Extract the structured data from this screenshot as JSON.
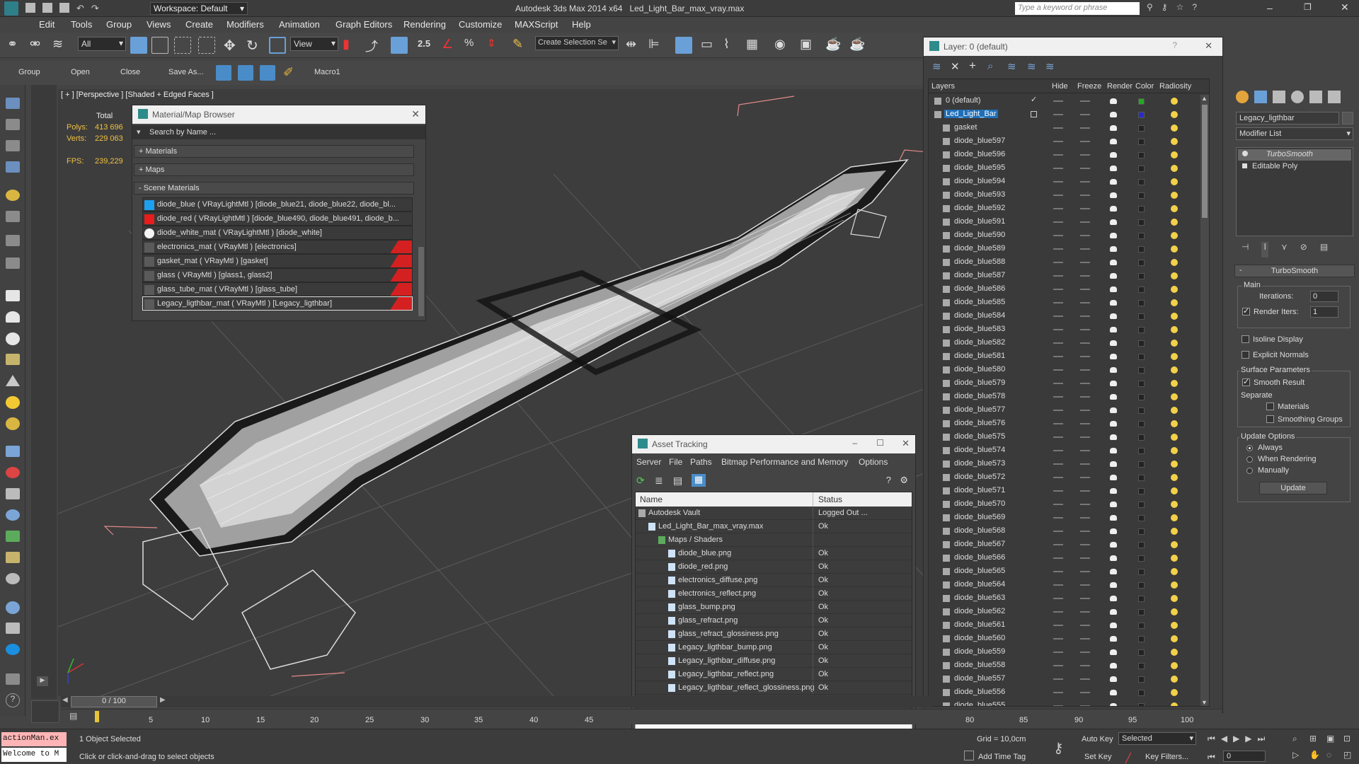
{
  "title_bar": {
    "workspace_label": "Workspace: Default",
    "app_title": "Autodesk 3ds Max  2014 x64",
    "file_title": "Led_Light_Bar_max_vray.max",
    "search_placeholder": "Type a keyword or phrase"
  },
  "menu": [
    "Edit",
    "Tools",
    "Group",
    "Views",
    "Create",
    "Modifiers",
    "Animation",
    "Graph Editors",
    "Rendering",
    "Customize",
    "MAXScript",
    "Help"
  ],
  "main_toolbar": {
    "selection_filter": "All",
    "ref_coord": "View",
    "snap_label": "2.5",
    "selection_set_placeholder": "Create Selection Se"
  },
  "ribbon": {
    "items": [
      "Group",
      "Open",
      "Close",
      "Save As..."
    ],
    "macro_label": "Macro1"
  },
  "viewport": {
    "label": "[ + ] [Perspective ] [Shaded + Edged Faces ]",
    "stats_total": "Total",
    "polys_label": "Polys:",
    "polys_value": "413 696",
    "verts_label": "Verts:",
    "verts_value": "229 063",
    "fps_label": "FPS:",
    "fps_value": "239,229"
  },
  "material_browser": {
    "title": "Material/Map Browser",
    "search_placeholder": "Search by Name ...",
    "sections": [
      "+ Materials",
      "+ Maps",
      "- Scene Materials"
    ],
    "items": [
      {
        "label": "diode_blue  ( VRayLightMtl ) [diode_blue21, diode_blue22, diode_bl...",
        "swatch": "#1ea0f0"
      },
      {
        "label": "diode_red  ( VRayLightMtl ) [diode_blue490, diode_blue491, diode_b...",
        "swatch": "#e81c1c"
      },
      {
        "label": "diode_white_mat  ( VRayLightMtl ) [diode_white]",
        "swatch": "#f4f4f4"
      },
      {
        "label": "electronics_mat  ( VRayMtl ) [electronics]",
        "swatch": "#5a5a5a"
      },
      {
        "label": "gasket_mat  ( VRayMtl ) [gasket]",
        "swatch": "#5a5a5a"
      },
      {
        "label": "glass  ( VRayMtl ) [glass1, glass2]",
        "swatch": "#5a5a5a"
      },
      {
        "label": "glass_tube_mat  ( VRayMtl ) [glass_tube]",
        "swatch": "#5a5a5a"
      },
      {
        "label": "Legacy_ligthbar_mat  ( VRayMtl ) [Legacy_ligthbar]",
        "swatch": "#5a5a5a"
      }
    ]
  },
  "layer_panel": {
    "title": "Layer: 0 (default)",
    "columns": [
      "Layers",
      "Hide",
      "Freeze",
      "Render",
      "Color",
      "Radiosity"
    ],
    "rows": [
      {
        "name": "0 (default)",
        "level": 0,
        "color": "#22aa22",
        "selected": false
      },
      {
        "name": "Led_Light_Bar",
        "level": 0,
        "color": "#2a2acc",
        "selected": true
      },
      {
        "name": "gasket",
        "level": 1,
        "color": "#222222",
        "selected": false
      },
      {
        "name": "diode_blue597",
        "level": 1,
        "color": "#222222",
        "selected": false
      },
      {
        "name": "diode_blue596",
        "level": 1,
        "color": "#222222",
        "selected": false
      },
      {
        "name": "diode_blue595",
        "level": 1,
        "color": "#222222",
        "selected": false
      },
      {
        "name": "diode_blue594",
        "level": 1,
        "color": "#222222",
        "selected": false
      },
      {
        "name": "diode_blue593",
        "level": 1,
        "color": "#222222",
        "selected": false
      },
      {
        "name": "diode_blue592",
        "level": 1,
        "color": "#222222",
        "selected": false
      },
      {
        "name": "diode_blue591",
        "level": 1,
        "color": "#222222",
        "selected": false
      },
      {
        "name": "diode_blue590",
        "level": 1,
        "color": "#222222",
        "selected": false
      },
      {
        "name": "diode_blue589",
        "level": 1,
        "color": "#222222",
        "selected": false
      },
      {
        "name": "diode_blue588",
        "level": 1,
        "color": "#222222",
        "selected": false
      },
      {
        "name": "diode_blue587",
        "level": 1,
        "color": "#222222",
        "selected": false
      },
      {
        "name": "diode_blue586",
        "level": 1,
        "color": "#222222",
        "selected": false
      },
      {
        "name": "diode_blue585",
        "level": 1,
        "color": "#222222",
        "selected": false
      },
      {
        "name": "diode_blue584",
        "level": 1,
        "color": "#222222",
        "selected": false
      },
      {
        "name": "diode_blue583",
        "level": 1,
        "color": "#222222",
        "selected": false
      },
      {
        "name": "diode_blue582",
        "level": 1,
        "color": "#222222",
        "selected": false
      },
      {
        "name": "diode_blue581",
        "level": 1,
        "color": "#222222",
        "selected": false
      },
      {
        "name": "diode_blue580",
        "level": 1,
        "color": "#222222",
        "selected": false
      },
      {
        "name": "diode_blue579",
        "level": 1,
        "color": "#222222",
        "selected": false
      },
      {
        "name": "diode_blue578",
        "level": 1,
        "color": "#222222",
        "selected": false
      },
      {
        "name": "diode_blue577",
        "level": 1,
        "color": "#222222",
        "selected": false
      },
      {
        "name": "diode_blue576",
        "level": 1,
        "color": "#222222",
        "selected": false
      },
      {
        "name": "diode_blue575",
        "level": 1,
        "color": "#222222",
        "selected": false
      },
      {
        "name": "diode_blue574",
        "level": 1,
        "color": "#222222",
        "selected": false
      },
      {
        "name": "diode_blue573",
        "level": 1,
        "color": "#222222",
        "selected": false
      },
      {
        "name": "diode_blue572",
        "level": 1,
        "color": "#222222",
        "selected": false
      },
      {
        "name": "diode_blue571",
        "level": 1,
        "color": "#222222",
        "selected": false
      },
      {
        "name": "diode_blue570",
        "level": 1,
        "color": "#222222",
        "selected": false
      },
      {
        "name": "diode_blue569",
        "level": 1,
        "color": "#222222",
        "selected": false
      },
      {
        "name": "diode_blue568",
        "level": 1,
        "color": "#222222",
        "selected": false
      },
      {
        "name": "diode_blue567",
        "level": 1,
        "color": "#222222",
        "selected": false
      },
      {
        "name": "diode_blue566",
        "level": 1,
        "color": "#222222",
        "selected": false
      },
      {
        "name": "diode_blue565",
        "level": 1,
        "color": "#222222",
        "selected": false
      },
      {
        "name": "diode_blue564",
        "level": 1,
        "color": "#222222",
        "selected": false
      },
      {
        "name": "diode_blue563",
        "level": 1,
        "color": "#222222",
        "selected": false
      },
      {
        "name": "diode_blue562",
        "level": 1,
        "color": "#222222",
        "selected": false
      },
      {
        "name": "diode_blue561",
        "level": 1,
        "color": "#222222",
        "selected": false
      },
      {
        "name": "diode_blue560",
        "level": 1,
        "color": "#222222",
        "selected": false
      },
      {
        "name": "diode_blue559",
        "level": 1,
        "color": "#222222",
        "selected": false
      },
      {
        "name": "diode_blue558",
        "level": 1,
        "color": "#222222",
        "selected": false
      },
      {
        "name": "diode_blue557",
        "level": 1,
        "color": "#222222",
        "selected": false
      },
      {
        "name": "diode_blue556",
        "level": 1,
        "color": "#222222",
        "selected": false
      },
      {
        "name": "diode_blue555",
        "level": 1,
        "color": "#222222",
        "selected": false
      }
    ]
  },
  "asset_tracking": {
    "title": "Asset Tracking",
    "menu": [
      "Server",
      "File",
      "Paths",
      "Bitmap Performance and Memory",
      "Options"
    ],
    "col_name": "Name",
    "col_status": "Status",
    "rows": [
      {
        "name": "Autodesk Vault",
        "status": "Logged Out ...",
        "level": 0
      },
      {
        "name": "Led_Light_Bar_max_vray.max",
        "status": "Ok",
        "level": 1
      },
      {
        "name": "Maps / Shaders",
        "status": "",
        "level": 2
      },
      {
        "name": "diode_blue.png",
        "status": "Ok",
        "level": 3
      },
      {
        "name": "diode_red.png",
        "status": "Ok",
        "level": 3
      },
      {
        "name": "electronics_diffuse.png",
        "status": "Ok",
        "level": 3
      },
      {
        "name": "electronics_reflect.png",
        "status": "Ok",
        "level": 3
      },
      {
        "name": "glass_bump.png",
        "status": "Ok",
        "level": 3
      },
      {
        "name": "glass_refract.png",
        "status": "Ok",
        "level": 3
      },
      {
        "name": "glass_refract_glossiness.png",
        "status": "Ok",
        "level": 3
      },
      {
        "name": "Legacy_ligthbar_bump.png",
        "status": "Ok",
        "level": 3
      },
      {
        "name": "Legacy_ligthbar_diffuse.png",
        "status": "Ok",
        "level": 3
      },
      {
        "name": "Legacy_ligthbar_reflect.png",
        "status": "Ok",
        "level": 3
      },
      {
        "name": "Legacy_ligthbar_reflect_glossiness.png",
        "status": "Ok",
        "level": 3
      }
    ]
  },
  "command_panel": {
    "object_name": "Legacy_ligthbar",
    "modifier_list": "Modifier List",
    "stack": [
      "TurboSmooth",
      "Editable Poly"
    ],
    "rollout_title": "TurboSmooth",
    "main_group": "Main",
    "iterations_label": "Iterations:",
    "iterations_value": "0",
    "render_iters_label": "Render Iters:",
    "render_iters_value": "1",
    "isoline_label": "Isoline Display",
    "explicit_normals_label": "Explicit Normals",
    "surface_params_label": "Surface Parameters",
    "smooth_result_label": "Smooth Result",
    "separate_label": "Separate",
    "materials_label": "Materials",
    "smoothing_groups_label": "Smoothing Groups",
    "update_options_label": "Update Options",
    "always_label": "Always",
    "when_rendering_label": "When Rendering",
    "manually_label": "Manually",
    "update_button": "Update"
  },
  "timeline": {
    "frame_label": "0 / 100",
    "ticks": [
      "5",
      "10",
      "15",
      "20",
      "25",
      "30",
      "35",
      "40",
      "45",
      "80",
      "85",
      "90",
      "95",
      "100"
    ]
  },
  "status_bar": {
    "maxscript_line1": "actionMan.ex",
    "maxscript_line2": "Welcome to M",
    "selection_status": "1 Object Selected",
    "prompt": "Click or click-and-drag to select objects",
    "grid": "Grid = 10,0cm",
    "add_time_tag": "Add Time Tag",
    "auto_key": "Auto Key",
    "auto_key_mode": "Selected",
    "set_key": "Set Key",
    "key_filters": "Key Filters...",
    "frame_value": "0"
  }
}
